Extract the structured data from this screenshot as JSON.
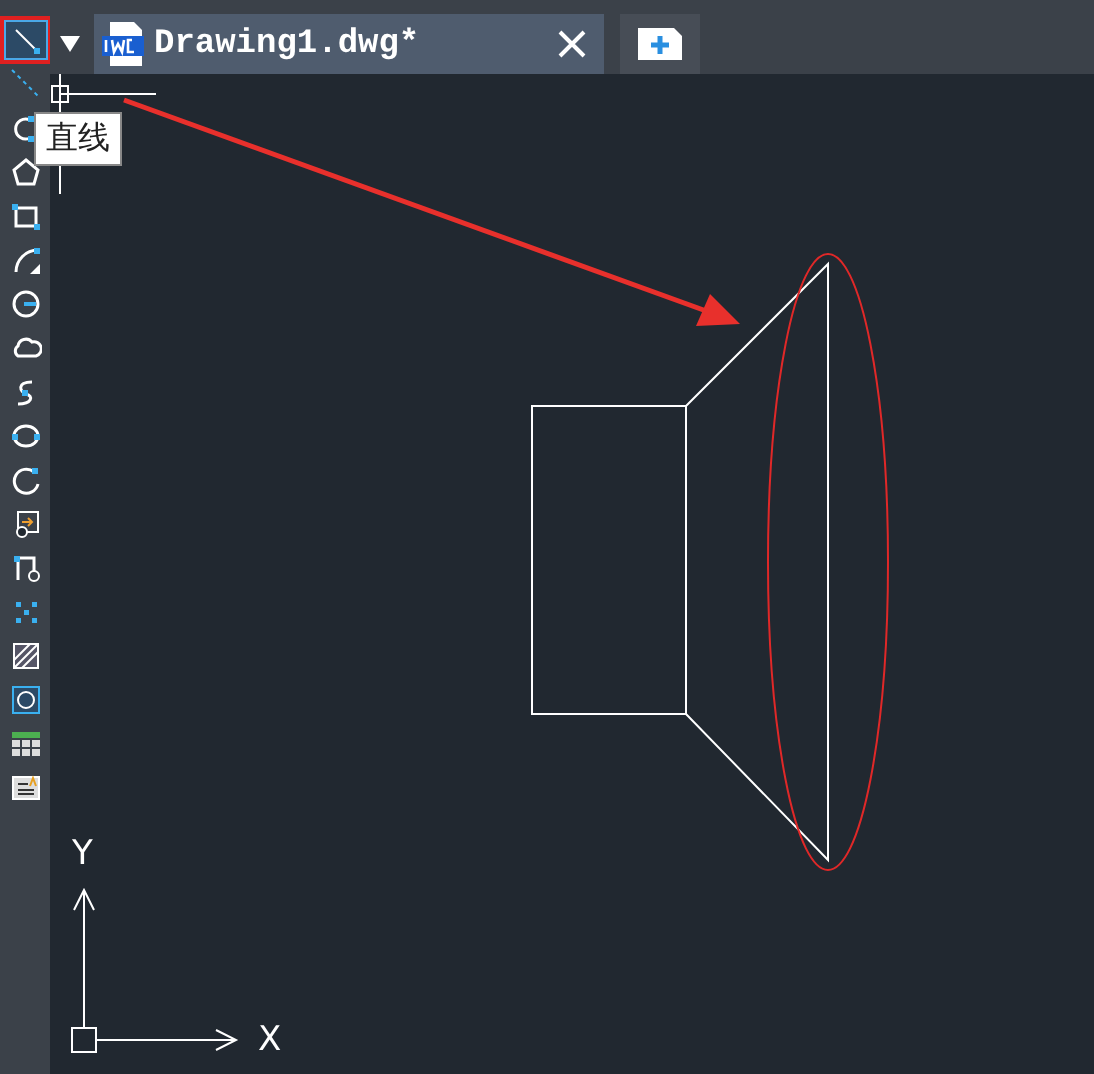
{
  "tools": [
    {
      "kind": "line",
      "selected": true
    },
    {
      "kind": "xline",
      "selected": false
    },
    {
      "kind": "polyline",
      "selected": false
    },
    {
      "kind": "polygon",
      "selected": false
    },
    {
      "kind": "rectangle",
      "selected": false
    },
    {
      "kind": "arc",
      "selected": false
    },
    {
      "kind": "circle",
      "selected": false
    },
    {
      "kind": "cloud",
      "selected": false
    },
    {
      "kind": "spline",
      "selected": false
    },
    {
      "kind": "ellipse",
      "selected": false
    },
    {
      "kind": "ellipse-arc",
      "selected": false
    },
    {
      "kind": "insert-block",
      "selected": false
    },
    {
      "kind": "make-block",
      "selected": false
    },
    {
      "kind": "points",
      "selected": false
    },
    {
      "kind": "hatch",
      "selected": false
    },
    {
      "kind": "region",
      "selected": false
    },
    {
      "kind": "table",
      "selected": false
    },
    {
      "kind": "text",
      "selected": false
    }
  ],
  "tabs": [
    {
      "title": "Drawing1.dwg*",
      "selected": true
    }
  ],
  "tooltip": "直线",
  "axes": {
    "y_label": "Y",
    "x_label": "X"
  }
}
